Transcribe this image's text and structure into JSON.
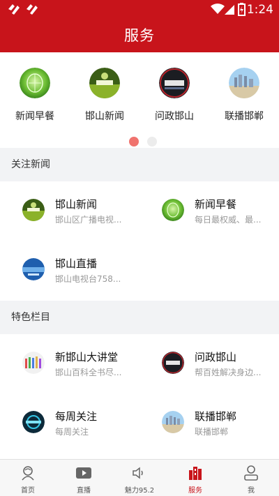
{
  "status_bar": {
    "time": "1:24"
  },
  "header": {
    "title": "服务"
  },
  "featured": [
    {
      "label": "新闻早餐",
      "icon": "green-globe-thumbnail"
    },
    {
      "label": "邯山新闻",
      "icon": "news-studio-thumbnail"
    },
    {
      "label": "问政邯山",
      "icon": "wenzheng-logo-thumbnail"
    },
    {
      "label": "联播邯郸",
      "icon": "skyline-thumbnail"
    }
  ],
  "carousel": {
    "active_page": 1,
    "pages": 2,
    "active_color": "#f0736e",
    "inactive_color": "#ececec"
  },
  "sections": [
    {
      "title": "关注新闻",
      "items": [
        {
          "name": "邯山新闻",
          "desc": "邯山区广播电视...",
          "icon": "news-studio-thumbnail"
        },
        {
          "name": "新闻早餐",
          "desc": "每日最权威、最...",
          "icon": "green-globe-thumbnail"
        },
        {
          "name": "邯山直播",
          "desc": "邯山电视台758...",
          "icon": "blue-live-thumbnail"
        }
      ]
    },
    {
      "title": "特色栏目",
      "items": [
        {
          "name": "新邯山大讲堂",
          "desc": "邯山百科全书尽...",
          "icon": "lecture-hall-thumbnail"
        },
        {
          "name": "问政邯山",
          "desc": "帮百姓解决身边...",
          "icon": "wenzheng-logo-thumbnail"
        },
        {
          "name": "每周关注",
          "desc": "每周关注",
          "icon": "weekly-focus-thumbnail"
        },
        {
          "name": "联播邯郸",
          "desc": "联播邯郸",
          "icon": "skyline-thumbnail"
        }
      ]
    }
  ],
  "tabs": [
    {
      "label": "首页",
      "icon": "home-icon",
      "active": false
    },
    {
      "label": "直播",
      "icon": "play-icon",
      "active": false
    },
    {
      "label": "魅力95.2",
      "icon": "speaker-icon",
      "active": false
    },
    {
      "label": "服务",
      "icon": "buildings-icon",
      "active": true
    },
    {
      "label": "我",
      "icon": "user-icon",
      "active": false
    }
  ],
  "colors": {
    "brand": "#c8141b",
    "section_bg": "#f2f3f5"
  }
}
